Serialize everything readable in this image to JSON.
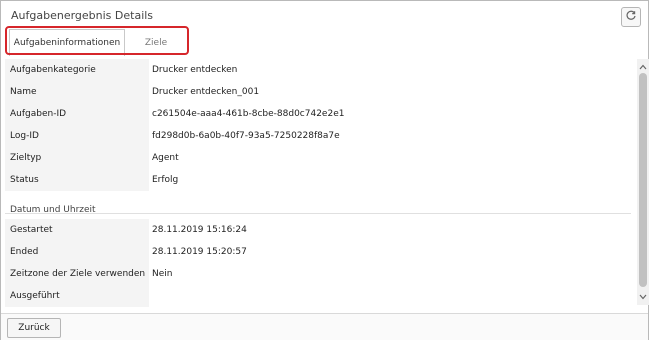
{
  "window": {
    "title": "Aufgabenergebnis Details"
  },
  "toolbar": {
    "refresh_icon": "refresh-icon"
  },
  "tabs": [
    {
      "label": "Aufgabeninformationen",
      "active": true
    },
    {
      "label": "Ziele",
      "active": false
    }
  ],
  "details": [
    {
      "key": "Aufgabenkategorie",
      "value": "Drucker entdecken"
    },
    {
      "key": "Name",
      "value": "Drucker entdecken_001"
    },
    {
      "key": "Aufgaben-ID",
      "value": "c261504e-aaa4-461b-8cbe-88d0c742e2e1"
    },
    {
      "key": "Log-ID",
      "value": "fd298d0b-6a0b-40f7-93a5-7250228f8a7e"
    },
    {
      "key": "Zieltyp",
      "value": "Agent"
    },
    {
      "key": "Status",
      "value": "Erfolg"
    }
  ],
  "datetime_section": {
    "label": "Datum und Uhrzeit",
    "rows": [
      {
        "key": "Gestartet",
        "value": "28.11.2019 15:16:24"
      },
      {
        "key": "Ended",
        "value": "28.11.2019 15:20:57"
      },
      {
        "key": "Zeitzone der Ziele verwenden",
        "value": "Nein"
      },
      {
        "key": "Ausgeführt",
        "value": ""
      }
    ]
  },
  "footer": {
    "back_label": "Zurück"
  },
  "colors": {
    "highlight": "#d6262b",
    "row_bg": "#f4f4f4",
    "border": "#c9c9c9"
  }
}
